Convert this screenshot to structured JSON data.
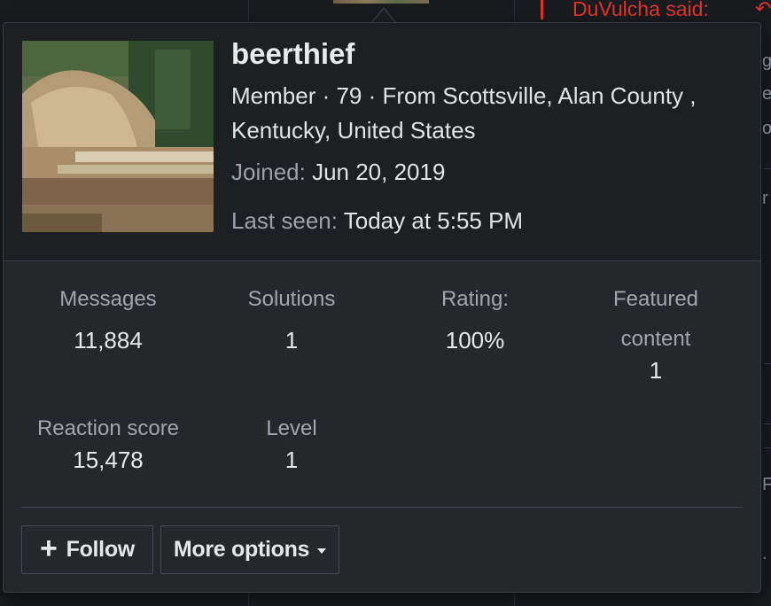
{
  "background": {
    "quote_author": "DuVulcha said:",
    "quote_icon": "reply-icon",
    "edge_fragments": [
      "g",
      "e",
      "o",
      "r",
      "F",
      "."
    ]
  },
  "profile": {
    "username": "beerthief",
    "info": "Member · 79 · From Scottsville, Alan County , Kentucky, United States",
    "joined_label": "Joined:",
    "joined_value": "Jun 20, 2019",
    "last_seen_label": "Last seen:",
    "last_seen_value": "Today at 5:55 PM",
    "avatar_description": "avatar-image"
  },
  "stats": [
    {
      "label": "Messages",
      "value": "11,884"
    },
    {
      "label": "Solutions",
      "value": "1"
    },
    {
      "label": "Rating:",
      "value": "100%"
    },
    {
      "label": "Featured content",
      "value": "1"
    },
    {
      "label": "Reaction score",
      "value": "15,478"
    },
    {
      "label": "Level",
      "value": "1"
    }
  ],
  "actions": {
    "follow_label": "Follow",
    "follow_icon": "plus-icon",
    "more_options_label": "More options",
    "more_options_icon": "caret-down-icon"
  },
  "colors": {
    "card_background": "#26272b",
    "header_background": "#1e1f22",
    "quote_accent": "#e0342b"
  }
}
